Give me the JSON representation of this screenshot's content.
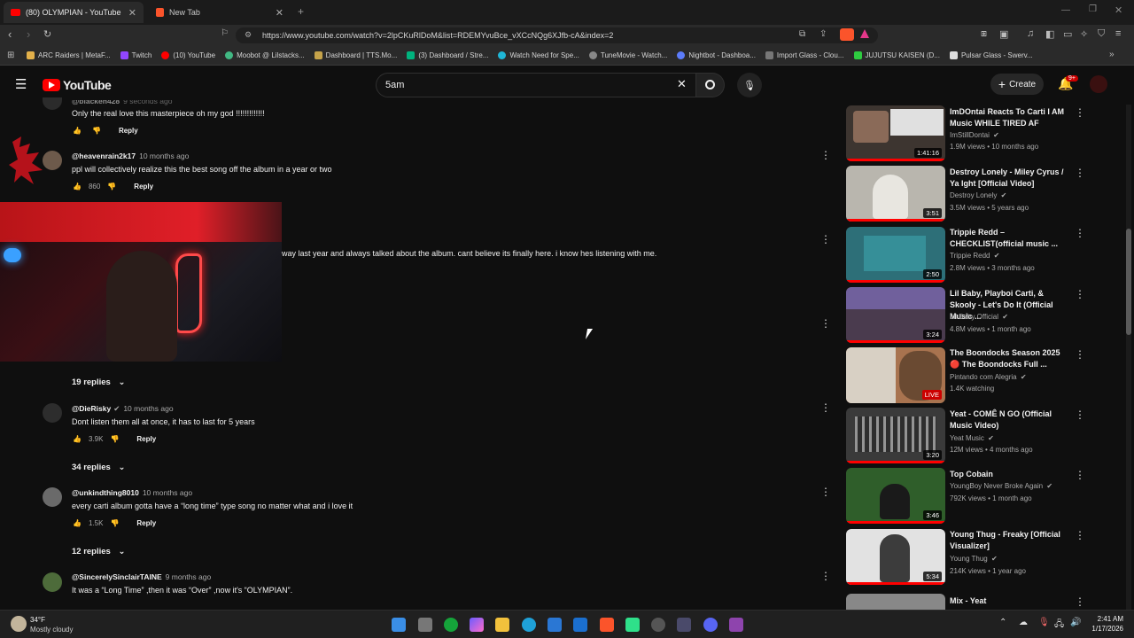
{
  "browser": {
    "tabs": [
      {
        "title": "(80) OLYMPIAN - YouTube",
        "active": true
      },
      {
        "title": "New Tab",
        "active": false
      }
    ],
    "url": "https://www.youtube.com/watch?v=2lpCKuRlDoM&list=RDEMYvuBce_vXCcNQg6XJfb-cA&index=2",
    "bookmarks": [
      {
        "label": "ARC Raiders | MetaF...",
        "color": "#e2b04a"
      },
      {
        "label": "Twitch",
        "color": "#9146ff"
      },
      {
        "label": "(10) YouTube",
        "color": "#ff0000"
      },
      {
        "label": "Moobot @ Lilstacks...",
        "color": "#41b883"
      },
      {
        "label": "Dashboard | TTS.Mo...",
        "color": "#c5a34a"
      },
      {
        "label": "(3) Dashboard / Stre...",
        "color": "#00b37e"
      },
      {
        "label": "Watch Need for Spe...",
        "color": "#1fb6d6"
      },
      {
        "label": "TuneMovie - Watch...",
        "color": "#888888"
      },
      {
        "label": "Nightbot - Dashboa...",
        "color": "#5c7cfa"
      },
      {
        "label": "Import Glass - Clou...",
        "color": "#777777"
      },
      {
        "label": "JUJUTSU KAISEN (D...",
        "color": "#2ecc40"
      },
      {
        "label": "Pulsar Glass - Swerv...",
        "color": "#dddddd"
      }
    ]
  },
  "youtube": {
    "logo": "YouTube",
    "search_value": "5am",
    "create_label": "Create",
    "notif_count": "9+"
  },
  "comments": {
    "c0": {
      "handle": "@blackeh428",
      "time": "9 seconds ago",
      "text": "Only the real love this masterpiece oh my god !!!!!!!!!!!!!",
      "reply": "Reply",
      "likes": ""
    },
    "c1": {
      "handle": "@heavenrain2k17",
      "time": "10 months ago",
      "text": "ppl will collectively realize this the best song off the album in a year or two",
      "likes": "860",
      "reply": "Reply"
    },
    "c2": {
      "text": "way last year and always talked about the album. cant believe its finally here. i know hes listening with me.",
      "replies": "19 replies"
    },
    "c3": {
      "handle": "@DieRisky",
      "time": "10 months ago",
      "text": "Dont listen them all at once, it has to last for 5 years",
      "likes": "3.9K",
      "reply": "Reply",
      "replies": "34 replies"
    },
    "c4": {
      "handle": "@unkindthing8010",
      "time": "10 months ago",
      "text": "every carti album gotta have a “long time” type song no matter what and i love it",
      "likes": "1.5K",
      "reply": "Reply",
      "replies": "12 replies"
    },
    "c5": {
      "handle": "@SincerelySinclairTAINE",
      "time": "9 months ago",
      "text": "It was a “Long Time” ,then it was “Over” ,now it's “OLYMPIAN”."
    }
  },
  "sidebar": [
    {
      "title": "ImDOntai Reacts To Carti I AM Music WHILE TIRED AF",
      "channel": "ImStillDontai",
      "meta": "1.9M views • 10 months ago",
      "duration": "1:41:16",
      "thumb": "#3d3530"
    },
    {
      "title": "Destroy Lonely - Miley Cyrus / Ya Ight [Official Video]",
      "channel": "Destroy Lonely",
      "meta": "3.5M views • 5 years ago",
      "duration": "3:51",
      "thumb": "#b9b6ae"
    },
    {
      "title": "Trippie Redd – CHECKLIST(official music ...",
      "channel": "Trippie Redd",
      "meta": "2.8M views • 3 months ago",
      "duration": "2:50",
      "thumb": "#2d6f78"
    },
    {
      "title": "Lil Baby, Playboi Carti, & Skooly - Let's Do It (Official Music ...",
      "channel": "Lil Baby Official",
      "meta": "4.8M views • 1 month ago",
      "duration": "3:24",
      "thumb": "#4a3b4e"
    },
    {
      "title": "The Boondocks Season 2025 🔴 The Boondocks Full ...",
      "channel": "Pintando com Alegria",
      "meta": "1.4K watching",
      "duration": "LIVE",
      "thumb": "#a8734f"
    },
    {
      "title": "Yeat - COMÊ N GO (Official Music Video)",
      "channel": "Yeat Music",
      "meta": "12M views • 4 months ago",
      "duration": "3:20",
      "thumb": "#555555"
    },
    {
      "title": "Top Cobain",
      "channel": "YoungBoy Never Broke Again",
      "meta": "792K views • 1 month ago",
      "duration": "3:46",
      "thumb": "#2f5e2a"
    },
    {
      "title": "Young Thug - Freaky [Official Visualizer]",
      "channel": "Young Thug",
      "meta": "214K views • 1 year ago",
      "duration": "5:34",
      "thumb": "#d9d9d9"
    },
    {
      "title": "Mix - Yeat",
      "channel": "",
      "meta": "",
      "duration": "",
      "thumb": "#888888"
    }
  ],
  "taskbar": {
    "weather_temp": "34°F",
    "weather_desc": "Mostly cloudy",
    "time": "2:41 AM",
    "date": "1/17/2026"
  }
}
